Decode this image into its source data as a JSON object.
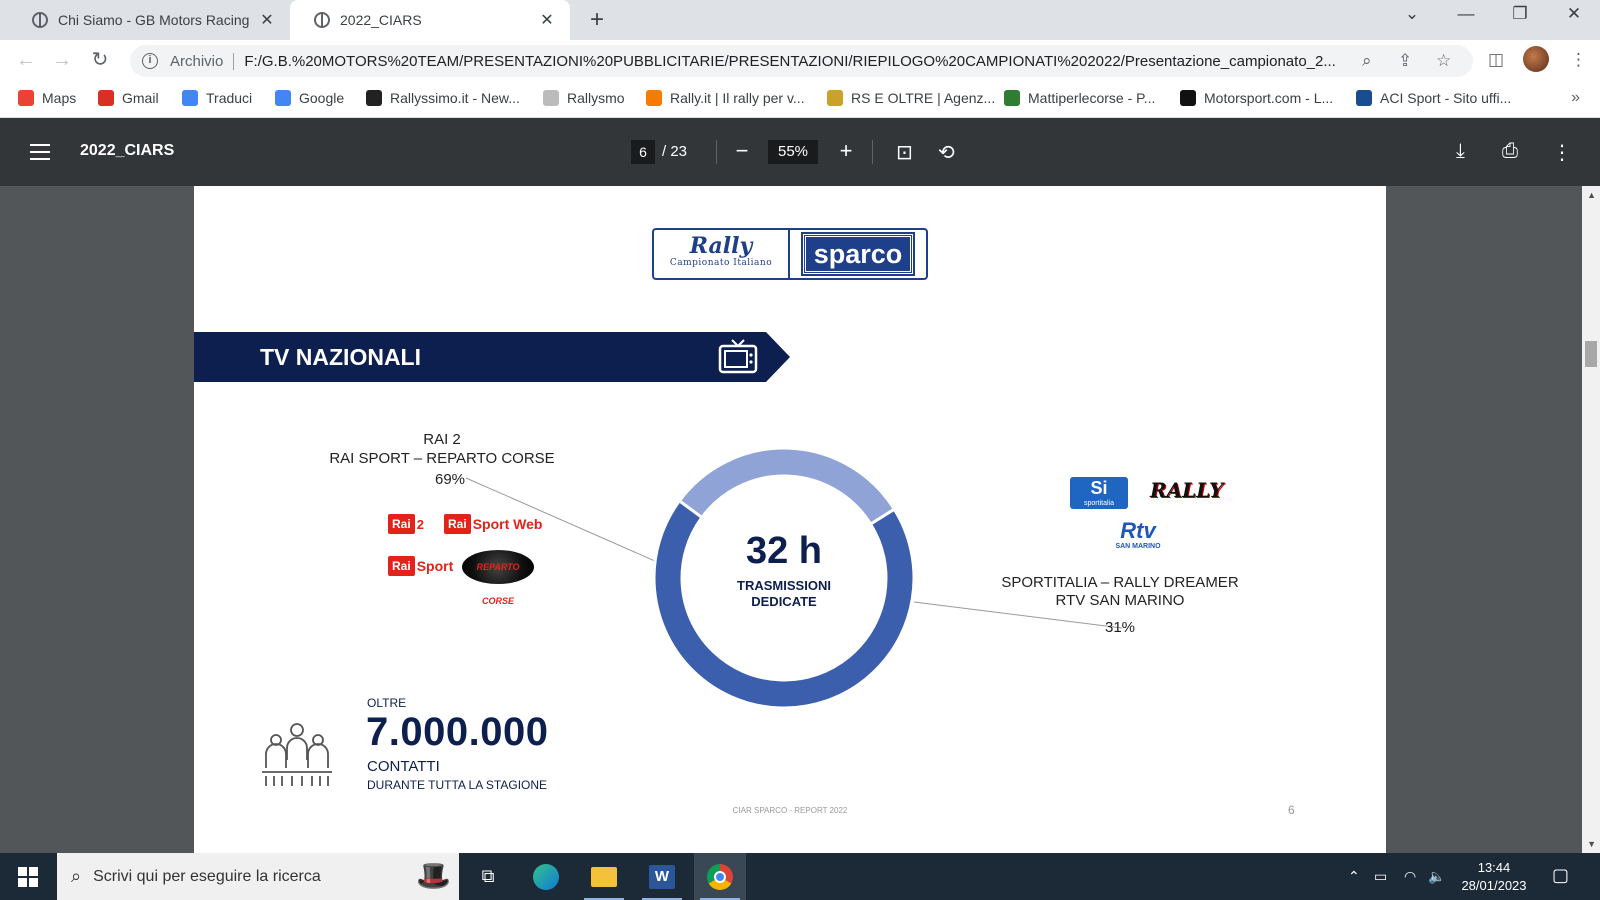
{
  "browser": {
    "tabs": [
      {
        "title": "Chi Siamo - GB Motors Racing",
        "active": false
      },
      {
        "title": "2022_CIARS",
        "active": true
      }
    ],
    "address_chip": "Archivio",
    "url": "F:/G.B.%20MOTORS%20TEAM/PRESENTAZIONI%20PUBBLICITARIE/PRESENTAZIONI/RIEPILOGO%20CAMPIONATI%202022/Presentazione_campionato_2...",
    "bookmarks": [
      {
        "label": "Maps",
        "color": "#ea4335"
      },
      {
        "label": "Gmail",
        "color": "#d93025"
      },
      {
        "label": "Traduci",
        "color": "#4285f4"
      },
      {
        "label": "Google",
        "color": "#4285f4"
      },
      {
        "label": "Rallyssimo.it - New...",
        "color": "#222222"
      },
      {
        "label": "Rallysmo",
        "color": "#bbbbbb"
      },
      {
        "label": "Rally.it | Il rally per v...",
        "color": "#f57c00"
      },
      {
        "label": "RS E OLTRE | Agenz...",
        "color": "#c9a227"
      },
      {
        "label": "Mattiperlecorse - P...",
        "color": "#2e7d32"
      },
      {
        "label": "Motorsport.com - L...",
        "color": "#111111"
      },
      {
        "label": "ACI Sport - Sito uffi...",
        "color": "#1a4d8f"
      }
    ]
  },
  "pdf_viewer": {
    "title": "2022_CIARS",
    "current_page": "6",
    "total_pages": "/ 23",
    "zoom": "55%"
  },
  "slide": {
    "logo_left_main": "Rally",
    "logo_left_sub": "Campionato Italiano",
    "logo_right": "sparco",
    "section_title": "TV NAZIONALI",
    "left_group": {
      "line1": "RAI 2",
      "line2": "RAI SPORT – REPARTO CORSE",
      "percent": "69%"
    },
    "right_group": {
      "line1": "SPORTITALIA – RALLY DREAMER",
      "line2": "RTV SAN MARINO",
      "percent": "31%"
    },
    "channel_logos": {
      "rai2_box": "Rai",
      "rai2_num": "2",
      "raisportweb_box": "Rai",
      "raisportweb_txt": "Sport Web",
      "raisport_box": "Rai",
      "raisport_txt": "Sport",
      "repartocorse": "REPARTO CORSE",
      "sportitalia": "Si",
      "sportitalia_sub": "sportitalia",
      "rallydreamer": "RALLY",
      "rtv": "Rtv",
      "rtv_sub": "SAN MARINO"
    },
    "center_value": "32 h",
    "center_sub_1": "TRASMISSIONI",
    "center_sub_2": "DEDICATE",
    "stat_prefix": "OLTRE",
    "stat_value": "7.000.000",
    "stat_label": "CONTATTI",
    "stat_sub": "DURANTE TUTTA LA STAGIONE",
    "footer": "CIAR SPARCO - REPORT 2022",
    "page_number": "6"
  },
  "chart_data": {
    "type": "pie",
    "categories": [
      "RAI 2 / RAI SPORT – REPARTO CORSE",
      "SPORTITALIA – RALLY DREAMER / RTV SAN MARINO"
    ],
    "values": [
      69,
      31
    ],
    "colors": [
      "#3b5fad",
      "#8fa3d6"
    ],
    "center_label": "32 h"
  },
  "taskbar": {
    "search_placeholder": "Scrivi qui per eseguire la ricerca",
    "time": "13:44",
    "date": "28/01/2023"
  }
}
